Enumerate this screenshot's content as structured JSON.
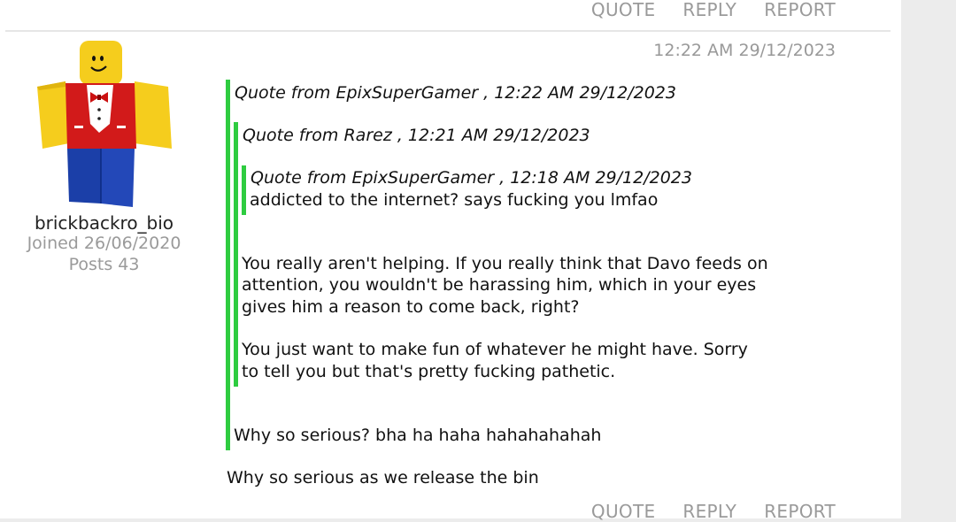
{
  "actions": {
    "quote": "QUOTE",
    "reply": "REPLY",
    "report": "REPORT"
  },
  "post": {
    "timestamp": "12:22 AM 29/12/2023",
    "author": {
      "username": "brickbackro_bio",
      "joined": "Joined 26/06/2020",
      "posts": "Posts 43"
    },
    "quote1": {
      "header": "Quote from EpixSuperGamer , 12:22 AM 29/12/2023",
      "quote2": {
        "header": "Quote from Rarez , 12:21 AM 29/12/2023",
        "quote3": {
          "header": "Quote from EpixSuperGamer , 12:18 AM 29/12/2023",
          "body": "addicted to the internet? says fucking you lmfao"
        },
        "body_p1": [
          "You really aren't helping. If you really think that Davo feeds on",
          "attention, you wouldn't be harassing him, which in your eyes",
          "gives him a reason to come back, right?"
        ],
        "body_p2": [
          "You just want to make fun of whatever he might have. Sorry",
          "to tell you but that's pretty fucking pathetic."
        ]
      },
      "body": "Why so serious? bha ha haha hahahahahah"
    },
    "body": "Why so serious as we release the bin"
  },
  "colors": {
    "quote_bar": "#2ecc40",
    "muted_text": "#9a9a9a"
  }
}
